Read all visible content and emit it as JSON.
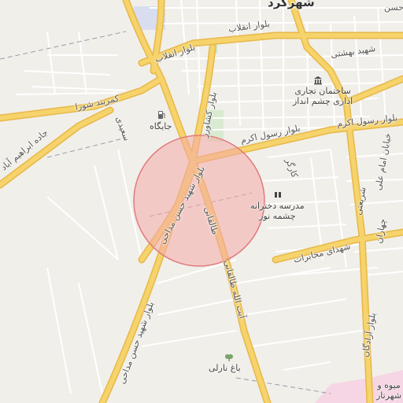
{
  "map": {
    "city_label": "شهرکرد",
    "highlight": {
      "fill": "#f4a9a9",
      "stroke": "#e07c7c"
    },
    "colors": {
      "major_road": "#f6d36b",
      "major_road_casing": "#e7b84a",
      "minor_road": "#ffffff",
      "background": "#f1efe9",
      "park": "#d9ead1",
      "water_area": "#d8def0",
      "residential": "#f6d6e4"
    },
    "roads": {
      "enghelab": "بلوار انقلاب",
      "keshavarz": "بلوار کشاورز",
      "kamarband_shoora": "کمربند شورا",
      "saeedi": "سعیدی",
      "ebrahim_abad": "جاده ابراهیم آباد",
      "shahid_hasan_madahi_1": "بلوار شهید حسن مداحی",
      "shahid_hasan_madahi_2": "بلوار شهید حسن مداحی",
      "rasool_akram": "بلوار رسول اکرم",
      "taleghani": "طالقانی",
      "ayatollah_taleghani": "آیت الله طالقانی",
      "kargar": "کارگر",
      "shahid_beheshti": "شهید بهشتی",
      "imam_ali": "خیابان امام علی",
      "shariati": "شریعتی",
      "chaharan": "چهاران",
      "shohada_mokhaberat": "شهدای مخابرات",
      "azadegan": "بلوار آزادگان",
      "hosein": "حسن"
    },
    "pois": {
      "gas_station": "جایگاه",
      "tejari_building": "ساختمان تجاری\nاداری چشم انداز",
      "school": "مدرسه دخترانه\nچشمه نور",
      "bagh_narli": "باغ نارلی",
      "fruit_market": "میوه و\nشهرتار"
    },
    "icons": [
      "fuel-icon",
      "bank-icon",
      "school-icon",
      "park-icon"
    ]
  }
}
